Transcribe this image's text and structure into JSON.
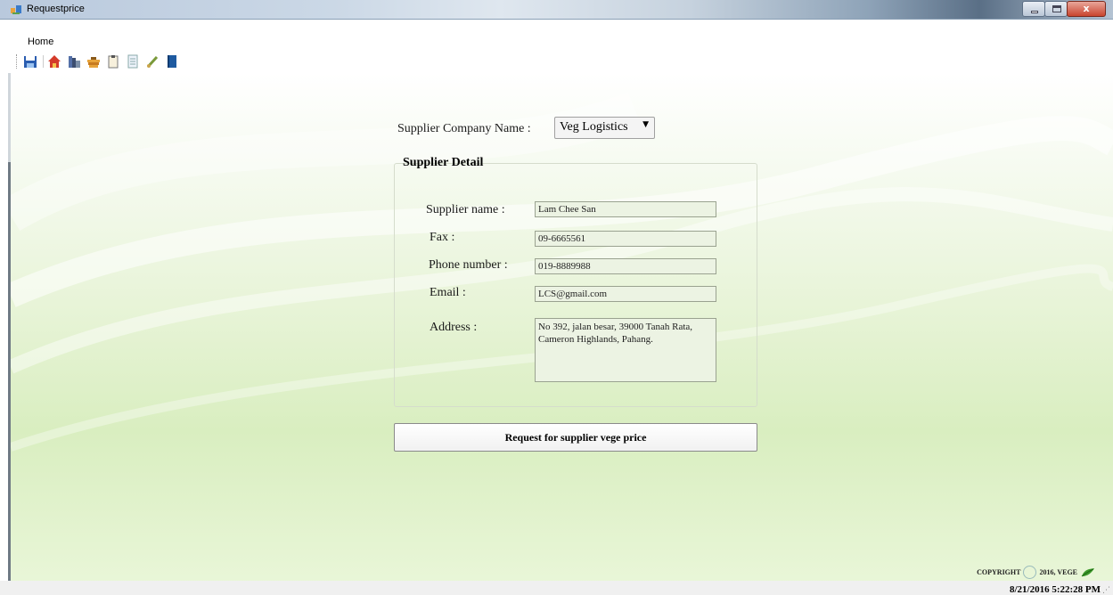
{
  "window": {
    "title": "Requestprice",
    "buttons": {
      "minimize": "minimize",
      "maximize": "maximize",
      "close": "x"
    }
  },
  "menu": {
    "home": "Home"
  },
  "toolbar": {
    "icons": [
      "save-icon",
      "home-icon",
      "books-icon",
      "stack-icon",
      "clipboard-icon",
      "document-icon",
      "brush-icon",
      "book-icon"
    ]
  },
  "form": {
    "company_label": "Supplier Company Name :",
    "company_value": "Veg Logistics",
    "group_title": "Supplier Detail",
    "fields": {
      "name_label": "Supplier name :",
      "name_value": "Lam Chee San",
      "fax_label": "Fax :",
      "fax_value": "09-6665561",
      "phone_label": "Phone number :",
      "phone_value": "019-8889988",
      "email_label": "Email :",
      "email_value": "LCS@gmail.com",
      "address_label": "Address :",
      "address_value": "No 392, jalan besar, 39000 Tanah Rata, Cameron Highlands, Pahang."
    },
    "request_button": "Request for supplier vege price"
  },
  "footer": {
    "copyright_prefix": "COPYRIGHT",
    "copyright_suffix": "2016, VEGE",
    "datetime": "8/21/2016 5:22:28 PM"
  },
  "colors": {
    "accent_green": "#d9eec0",
    "field_bg": "#ecf3e3"
  }
}
